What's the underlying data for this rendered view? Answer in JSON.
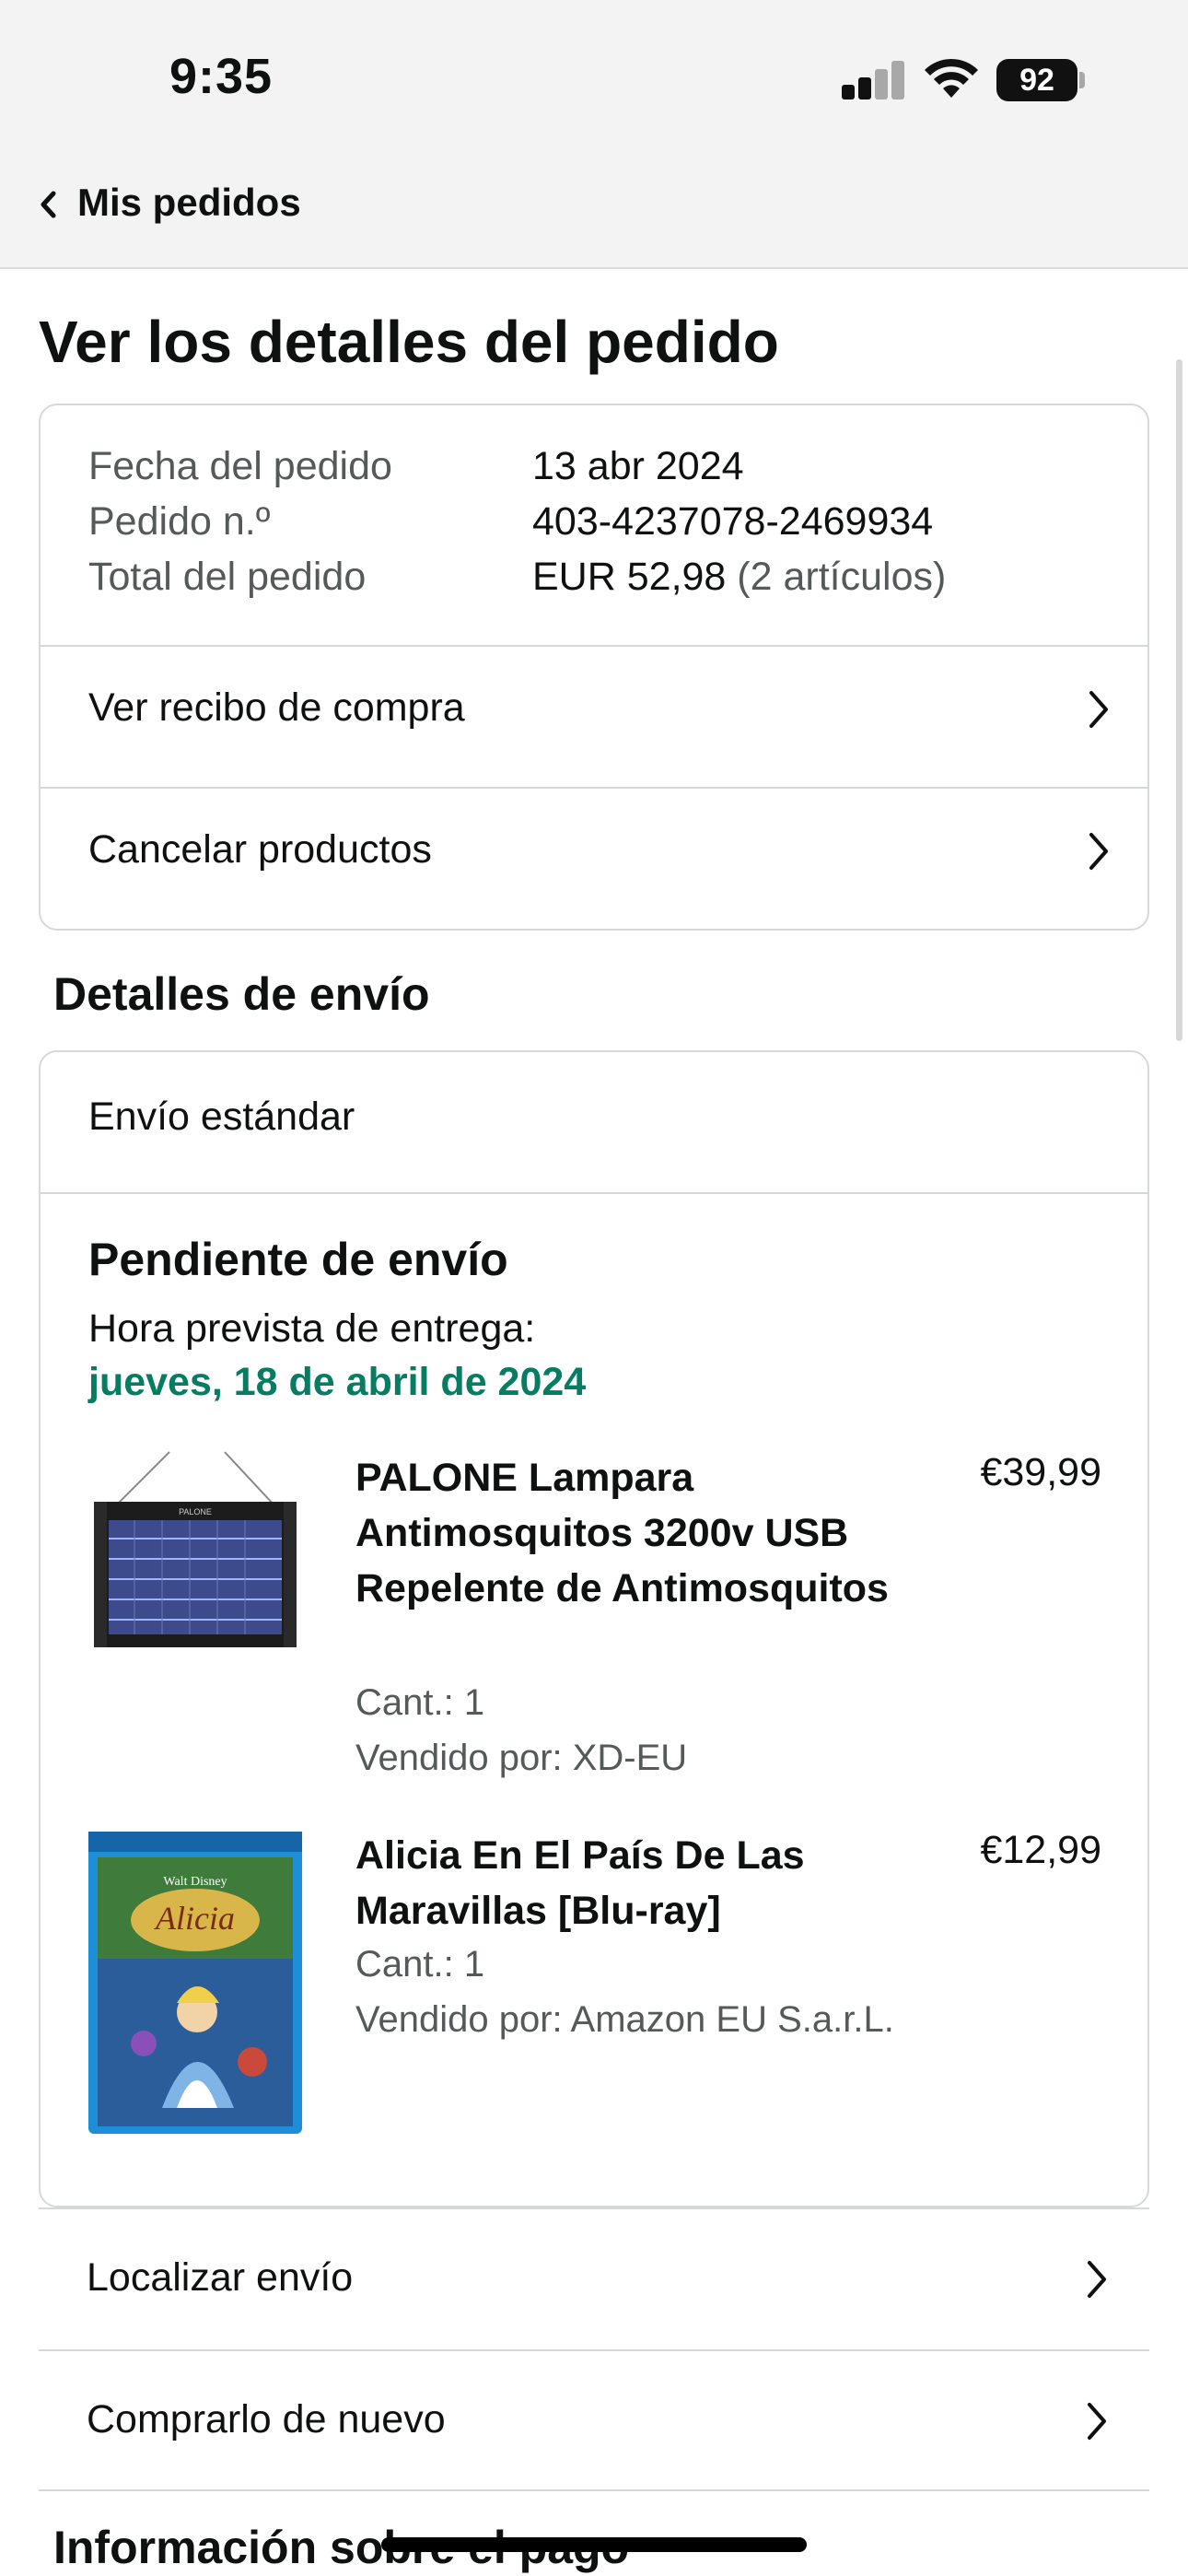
{
  "status_bar": {
    "time": "9:35",
    "battery": "92"
  },
  "nav": {
    "back_label": "Mis pedidos"
  },
  "page": {
    "title": "Ver los detalles del pedido"
  },
  "order": {
    "date_label": "Fecha del pedido",
    "date_value": "13 abr 2024",
    "number_label": "Pedido n.º",
    "number_value": "403-4237078-2469934",
    "total_label": "Total del pedido",
    "total_value": "EUR 52,98",
    "total_items": "(2 artículos)"
  },
  "order_actions": [
    {
      "label": "Ver recibo de compra"
    },
    {
      "label": "Cancelar productos"
    }
  ],
  "shipping": {
    "section_title": "Detalles de envío",
    "method": "Envío estándar",
    "status": "Pendiente de envío",
    "eta_label": "Hora prevista de entrega:",
    "eta_date": "jueves, 18 de abril de 2024"
  },
  "products": [
    {
      "title": "PALONE Lampara Antimosquitos 3200v USB Repelente de Antimosquitos",
      "price": "€39,99",
      "qty": "Cant.: 1",
      "seller": "Vendido por: XD-EU",
      "image_icon": "bug-zapper-lamp-image",
      "image_brand": "PALONE"
    },
    {
      "title": "Alicia En El País De Las Maravillas [Blu-ray]",
      "price": "€12,99",
      "qty": "Cant.: 1",
      "seller": "Vendido por: Amazon EU S.a.r.L.",
      "image_icon": "bluray-cover-image",
      "image_brand": "Walt Disney",
      "image_title": "Alicia"
    }
  ],
  "shipment_actions": [
    {
      "label": "Localizar envío"
    },
    {
      "label": "Comprarlo de nuevo"
    }
  ],
  "payment": {
    "section_title": "Información sobre el pago"
  },
  "colors": {
    "eta_green": "#067d62",
    "border": "#d5d9d9",
    "muted": "#565959",
    "header_bg": "#f3f3f3"
  }
}
